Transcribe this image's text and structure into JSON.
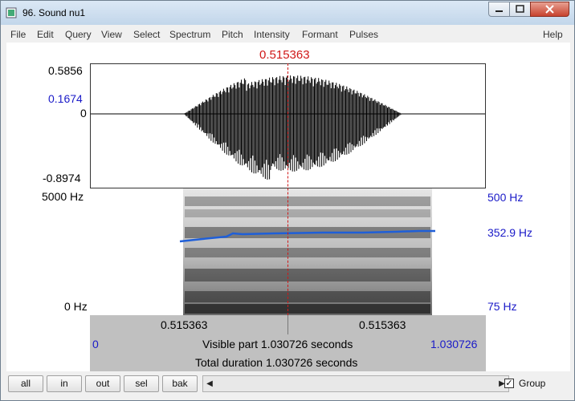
{
  "window": {
    "title": "96. Sound nu1"
  },
  "menu": {
    "file": "File",
    "edit": "Edit",
    "query": "Query",
    "view": "View",
    "select": "Select",
    "spectrum": "Spectrum",
    "pitch": "Pitch",
    "intensity": "Intensity",
    "formant": "Formant",
    "pulses": "Pulses",
    "help": "Help"
  },
  "cursor": {
    "time": "0.515363"
  },
  "waveform": {
    "max": "0.5856",
    "mark": "0.1674",
    "zero": "0",
    "min": "-0.8974"
  },
  "spectrogram": {
    "top_left": "5000 Hz",
    "bottom_left": "0 Hz",
    "pitch_top": "500 Hz",
    "pitch_value": "352.9 Hz",
    "pitch_bottom": "75 Hz"
  },
  "bars": {
    "left_time": "0.515363",
    "right_time": "0.515363",
    "visible_start": "0",
    "visible_label": "Visible part 1.030726 seconds",
    "visible_end": "1.030726",
    "total_label": "Total duration 1.030726 seconds"
  },
  "buttons": {
    "all": "all",
    "in": "in",
    "out": "out",
    "sel": "sel",
    "bak": "bak"
  },
  "group": {
    "label": "Group",
    "checked": true
  },
  "colors": {
    "pitch": "#1f5fd8",
    "cursor": "#d01818",
    "label_blue": "#1a1ac8"
  }
}
